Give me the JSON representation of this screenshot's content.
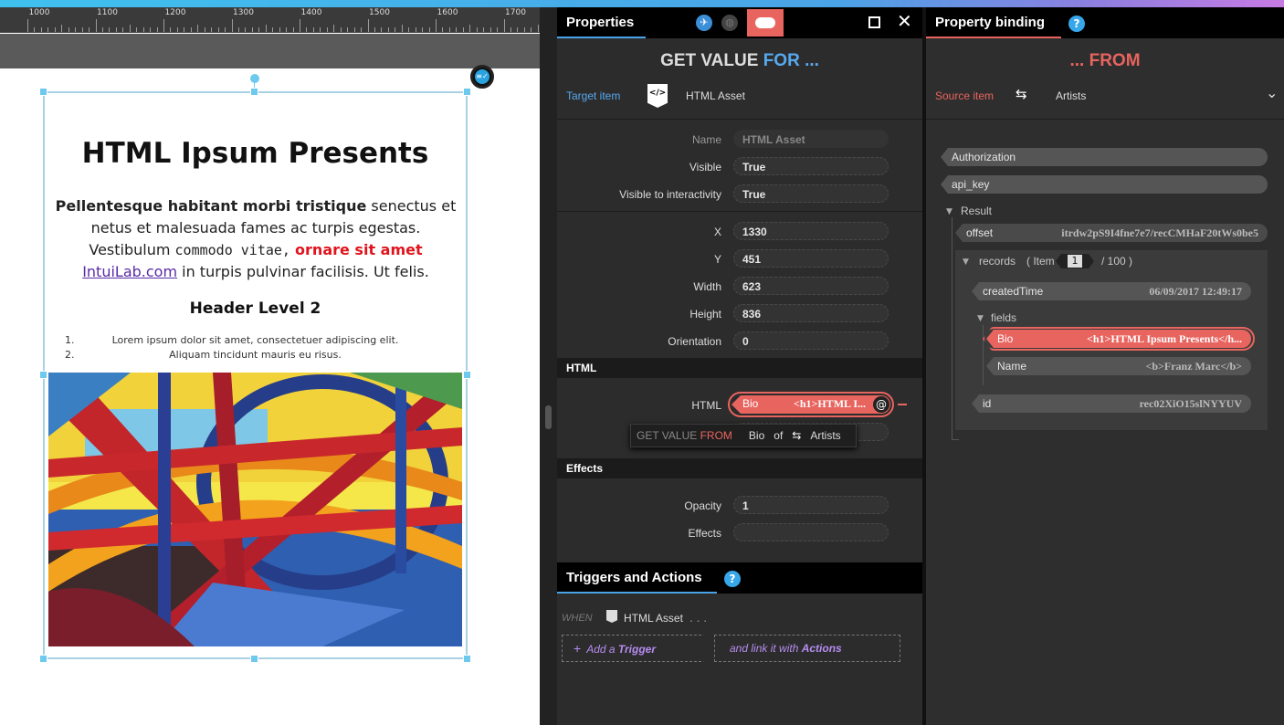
{
  "ruler": {
    "labels": [
      "1000",
      "1100",
      "1200",
      "1300",
      "1400",
      "1500",
      "1600",
      "1700"
    ]
  },
  "doc": {
    "h1": "HTML Ipsum Presents",
    "para": {
      "bold": "Pellentesque habitant morbi tristique",
      "t1": " senectus et netus et malesuada fames ac turpis egestas. Vestibulum ",
      "code": "commodo vitae,",
      "t2": " ",
      "red": "ornare sit amet",
      "t3": " ",
      "link": "IntuiLab.com",
      "t4": " in turpis pulvinar facilisis. Ut felis."
    },
    "h2": "Header Level 2",
    "list": [
      {
        "n": "1.",
        "text": "Lorem ipsum dolor sit amet, consectetuer adipiscing elit."
      },
      {
        "n": "2.",
        "text": "Aliquam tincidunt mauris eu risus."
      }
    ]
  },
  "properties": {
    "tab": "Properties",
    "close_glyph": "✕",
    "title_a": "GET VALUE ",
    "title_b": "FOR ...",
    "target_label": "Target item",
    "target_value": "HTML Asset",
    "fields": [
      {
        "label": "Name",
        "value": "HTML Asset"
      },
      {
        "label": "Visible",
        "value": "True"
      },
      {
        "label": "Visible to interactivity",
        "value": "True"
      },
      {
        "label": "X",
        "value": "1330"
      },
      {
        "label": "Y",
        "value": "451"
      },
      {
        "label": "Width",
        "value": "623"
      },
      {
        "label": "Height",
        "value": "836"
      },
      {
        "label": "Orientation",
        "value": "0"
      }
    ],
    "html_section": "HTML",
    "html_label": "HTML",
    "html_binding": {
      "key": "Bio",
      "value": "<h1>HTML I..."
    },
    "tooltip": {
      "a": "GET VALUE ",
      "b": "FROM",
      "c": "Bio",
      "d": "of",
      "e": "Artists"
    },
    "effects_section": "Effects",
    "opacity_label": "Opacity",
    "opacity_value": "1",
    "effects_label": "Effects",
    "triggers_tab": "Triggers and Actions",
    "when": "WHEN",
    "when_item": "HTML Asset",
    "when_dots": ". . .",
    "add_trigger_a": "Add a ",
    "add_trigger_b": "Trigger",
    "link_actions_a": "and link it with ",
    "link_actions_b": "Actions",
    "help": "?"
  },
  "binding": {
    "tab": "Property binding",
    "help": "?",
    "title": "... FROM",
    "source_label": "Source item",
    "source_value": "Artists",
    "items": [
      {
        "key": "Authorization"
      },
      {
        "key": "api_key"
      }
    ],
    "result_label": "Result",
    "offset": {
      "key": "offset",
      "value": "itrdw2pS9I4fne7e7/recCMHaF20tWs0be5"
    },
    "records": {
      "label": "records",
      "item_a": "( Item",
      "item_num": "1",
      "item_b": "/ 100 )"
    },
    "createdTime": {
      "key": "createdTime",
      "value": "06/09/2017 12:49:17"
    },
    "fields_label": "fields",
    "bio": {
      "key": "Bio",
      "value": "<h1>HTML Ipsum Presents</h..."
    },
    "name": {
      "key": "Name",
      "value": "<b>Franz Marc</b>"
    },
    "id": {
      "key": "id",
      "value": "rec02XiO15slNYYUV"
    }
  }
}
